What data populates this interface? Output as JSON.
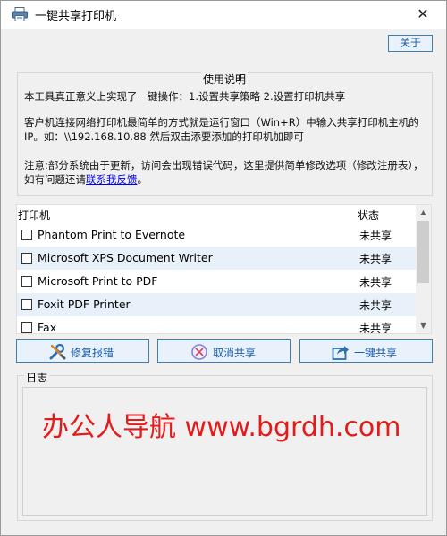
{
  "window": {
    "title": "一键共享打印机",
    "close_glyph": "✕"
  },
  "toolbar": {
    "about_label": "关于"
  },
  "instructions": {
    "title": "使用说明",
    "line1": "本工具真正意义上实现了一键操作：1.设置共享策略 2.设置打印机共享",
    "line2": "客户机连接网络打印机最简单的方式就是运行窗口（Win+R）中输入共享打印机主机的IP。如：\\\\192.168.10.88 然后双击添要添加的打印机加即可",
    "line3_prefix": "注意:部分系统由于更新，访问会出现错误代码，这里提供简单修改选项（修改注册表），如有问题还请",
    "line3_link": "联系我反馈",
    "line3_suffix": "。"
  },
  "printer_list": {
    "col_printer": "打印机",
    "col_status": "状态",
    "rows": [
      {
        "name": "Phantom Print to Evernote",
        "status": "未共享"
      },
      {
        "name": "Microsoft XPS Document Writer",
        "status": "未共享"
      },
      {
        "name": "Microsoft Print to PDF",
        "status": "未共享"
      },
      {
        "name": "Foxit PDF Printer",
        "status": "未共享"
      },
      {
        "name": "Fax",
        "status": "未共享"
      }
    ]
  },
  "actions": {
    "repair_label": "修复报错",
    "cancel_label": "取消共享",
    "share_label": "一键共享"
  },
  "log": {
    "title": "日志",
    "content": ""
  },
  "watermark": "办公人导航 www.bgrdh.com",
  "colors": {
    "accent": "#1b5ea6",
    "button_border": "#3c7fb1",
    "button_bg": "#e9f1fb",
    "row_alt": "#e8f1fa",
    "watermark": "#e41b1b",
    "link": "#0000ee"
  },
  "icons": {
    "app": "printer-icon",
    "repair": "wrench-screwdriver-icon",
    "cancel": "cancel-circle-icon",
    "share": "share-arrow-icon"
  }
}
